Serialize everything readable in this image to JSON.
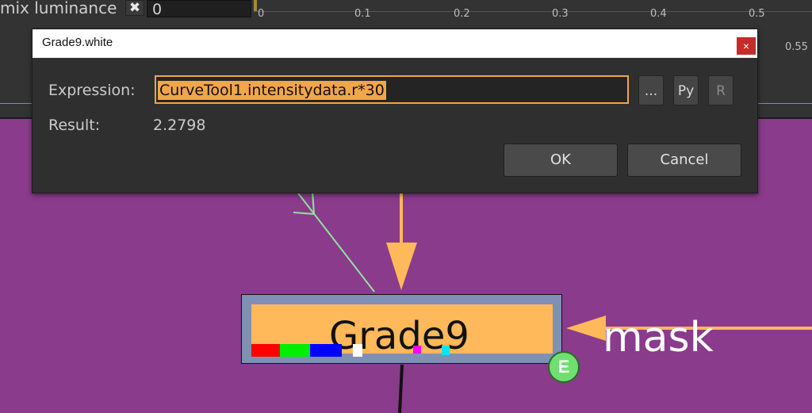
{
  "topbar": {
    "label": "mix luminance",
    "x_glyph": "✖",
    "value": "0",
    "ticks": [
      "0",
      "0.1",
      "0.2",
      "0.3",
      "0.4",
      "0.5",
      "0.55"
    ]
  },
  "dialog": {
    "title": "Grade9.white",
    "close_glyph": "×",
    "expression_label": "Expression:",
    "expression_value": "CurveTool1.intensitydata.r*30",
    "result_label": "Result:",
    "result_value": "2.2798",
    "browse_label": "...",
    "py_label": "Py",
    "r_label": "R",
    "ok_label": "OK",
    "cancel_label": "Cancel"
  },
  "node": {
    "name": "Grade9",
    "badge": "E",
    "channel_colors": [
      "#ff0000",
      "#00ee00",
      "#0000ff",
      "#ffffff",
      "#ff00ff",
      "#00e5ff"
    ]
  },
  "mask_label": "mask",
  "colors": {
    "graph_bg": "#8a3b8c",
    "pipe": "#ffb85a",
    "link_green": "#8fe39a",
    "focus": "#f0a64a"
  }
}
